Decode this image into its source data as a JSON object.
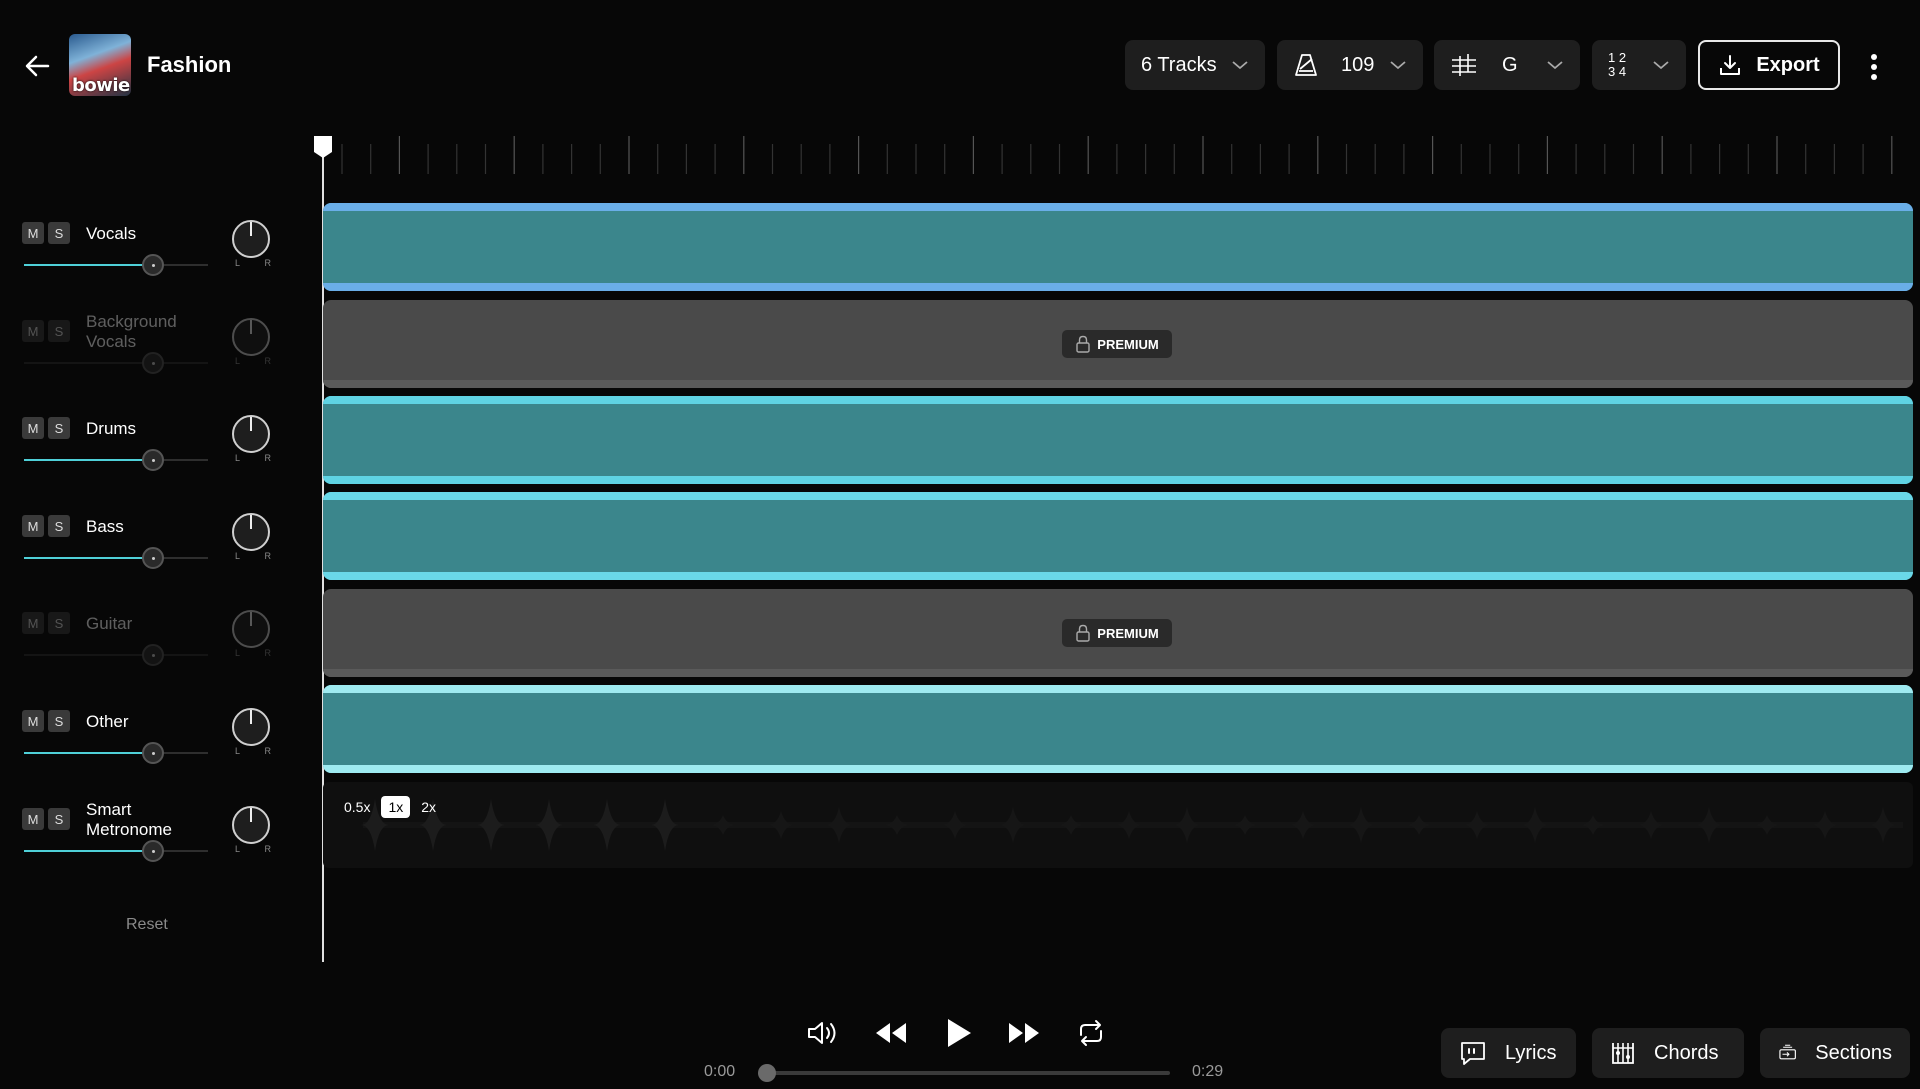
{
  "header": {
    "song_title": "Fashion",
    "album_art_text": "bowie",
    "tracks_label": "6 Tracks",
    "tempo_value": "109",
    "key_value": "G",
    "time_signature_top": "1 2",
    "time_signature_bottom": "3 4",
    "export_label": "Export"
  },
  "tracks": [
    {
      "name": "Vocals",
      "enabled": true,
      "mute": "M",
      "solo": "S",
      "volume": 0.7,
      "color": "#6aaee8"
    },
    {
      "name": "Background Vocals",
      "enabled": false,
      "mute": "M",
      "solo": "S",
      "volume": 0.7,
      "premium": "PREMIUM"
    },
    {
      "name": "Drums",
      "enabled": true,
      "mute": "M",
      "solo": "S",
      "volume": 0.7,
      "color": "#5fd3e3"
    },
    {
      "name": "Bass",
      "enabled": true,
      "mute": "M",
      "solo": "S",
      "volume": 0.7,
      "color": "#6ad8e8"
    },
    {
      "name": "Guitar",
      "enabled": false,
      "mute": "M",
      "solo": "S",
      "volume": 0.7,
      "premium": "PREMIUM"
    },
    {
      "name": "Other",
      "enabled": true,
      "mute": "M",
      "solo": "S",
      "volume": 0.7,
      "color": "#9eeaf0"
    },
    {
      "name": "Smart Metronome",
      "enabled": true,
      "mute": "M",
      "solo": "S",
      "volume": 0.7
    }
  ],
  "pan_labels": {
    "left": "L",
    "right": "R"
  },
  "reset_label": "Reset",
  "metronome": {
    "speeds": [
      "0.5x",
      "1x",
      "2x"
    ],
    "active_speed": "1x"
  },
  "transport": {
    "current_time": "0:00",
    "total_time": "0:29",
    "progress": 0.0
  },
  "footer": {
    "lyrics_label": "Lyrics",
    "chords_label": "Chords",
    "sections_label": "Sections"
  },
  "colors": {
    "lane_teal": "#3b868c",
    "premium_lane": "#4a4a4a",
    "accent": "#4fd0d8"
  }
}
